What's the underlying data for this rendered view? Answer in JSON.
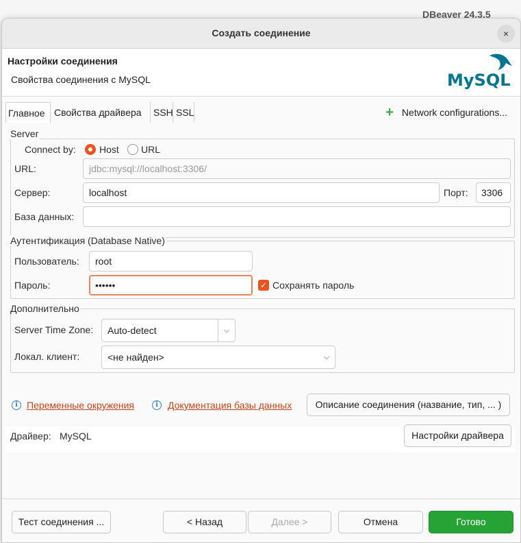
{
  "background_app": {
    "title": "DBeaver 24.3.5"
  },
  "dialog": {
    "title": "Создать соединение",
    "close_symbol": "×",
    "header": {
      "title": "Настройки соединения",
      "subtitle": "Свойства соединения с MySQL",
      "logo_text": "MySQL"
    },
    "tabs": [
      {
        "label": "Главное",
        "active": true
      },
      {
        "label": "Свойства драйвера",
        "active": false
      },
      {
        "label": "SSH",
        "active": false
      },
      {
        "label": "SSL",
        "active": false
      }
    ],
    "network_config": {
      "icon": "plus-icon",
      "label": "Network configurations..."
    },
    "server": {
      "group_label": "Server",
      "connect_by_label": "Connect by:",
      "options": [
        {
          "label": "Host",
          "selected": true
        },
        {
          "label": "URL",
          "selected": false
        }
      ],
      "url_label": "URL:",
      "url_value": "jdbc:mysql://localhost:3306/",
      "server_label": "Сервер:",
      "server_value": "localhost",
      "port_label": "Порт:",
      "port_value": "3306",
      "database_label": "База данных:",
      "database_value": ""
    },
    "auth": {
      "group_label": "Аутентификация (Database Native)",
      "user_label": "Пользователь:",
      "user_value": "root",
      "password_label": "Пароль:",
      "password_value": "••••••",
      "save_password_label": "Сохранять пароль",
      "save_password_checked": true
    },
    "advanced": {
      "group_label": "Дополнительно",
      "timezone_label": "Server Time Zone:",
      "timezone_value": "Auto-detect",
      "client_label": "Локал. клиент:",
      "client_value": "<не найден>"
    },
    "links": {
      "env_vars": "Переменные окружения",
      "db_docs": "Документация базы данных",
      "description_button": "Описание соединения (название, тип, ... )"
    },
    "driver": {
      "label": "Драйвер:",
      "value": "MySQL",
      "settings_button": "Настройки драйвера"
    },
    "footer": {
      "test": "Тест соединения ...",
      "back": "< Назад",
      "next": "Далее >",
      "cancel": "Отмена",
      "finish": "Готово"
    },
    "colors": {
      "accent": "#e95420",
      "link": "#c3431b",
      "finish_button": "#26a334",
      "info_icon": "#3a7fc1",
      "mysql_blue": "#00758f",
      "mysql_orange": "#f29111"
    }
  }
}
